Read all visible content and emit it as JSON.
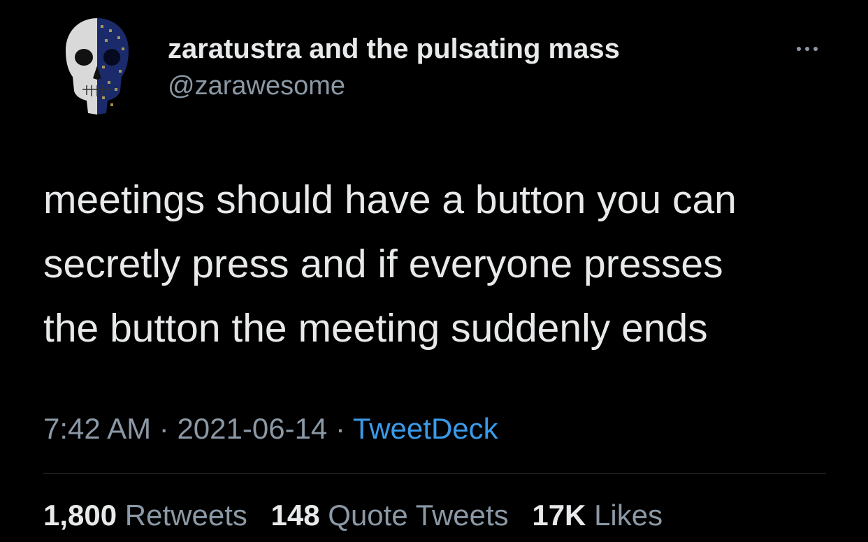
{
  "user": {
    "display_name": "zaratustra and the pulsating mass",
    "handle": "@zarawesome",
    "avatar_icon": "skull-avatar"
  },
  "more_icon": "ellipsis-icon",
  "tweet": {
    "lines": [
      "meetings should have a button you can",
      "secretly press and if everyone presses",
      "the button the meeting suddenly ends"
    ]
  },
  "meta": {
    "time": "7:42 AM",
    "separator": "·",
    "date": "2021-06-14",
    "source": "TweetDeck"
  },
  "stats": {
    "retweets_count": "1,800",
    "retweets_label": "Retweets",
    "quotes_count": "148",
    "quotes_label": "Quote Tweets",
    "likes_count": "17K",
    "likes_label": "Likes"
  },
  "colors": {
    "background": "#000000",
    "primary_text": "#e7e9ea",
    "secondary_text": "#8b98a5",
    "link": "#3b9ae8",
    "divider": "#2f3336"
  }
}
